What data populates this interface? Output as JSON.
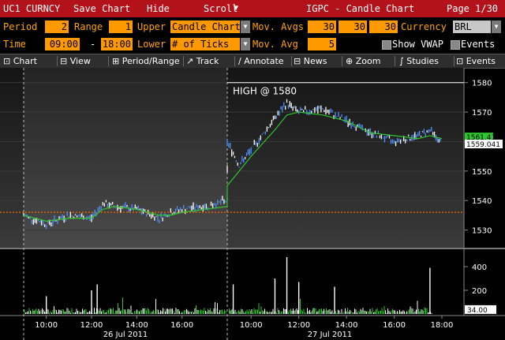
{
  "titlebar": {
    "ticker": "UC1 CURNCY",
    "save_chart": "Save Chart",
    "hide": "Hide",
    "scroll": "Scroll",
    "scroll_dropdown": "▼",
    "title": "IGPC - Candle Chart",
    "page": "Page 1/30"
  },
  "settings": {
    "period_label": "Period",
    "period_value": "2",
    "range_label": "Range",
    "range_value": "1",
    "upper_label": "Upper",
    "upper_value": "Candle Chart",
    "mov_avgs_label": "Mov. Avgs",
    "mov_avgs_values": [
      "30",
      "30",
      "30"
    ],
    "currency_label": "Currency",
    "currency_value": "BRL",
    "time_label": "Time",
    "time_start": "09:00",
    "time_sep": "-",
    "time_end": "18:00",
    "lower_label": "Lower",
    "lower_value": "# of Ticks",
    "mov_avg_label": "Mov. Avg",
    "mov_avg_value": "5",
    "show_vwap_label": "Show VWAP",
    "events_label": "Events"
  },
  "toolbar": {
    "items": [
      {
        "label": "Chart",
        "icon": "chart-icon"
      },
      {
        "label": "View",
        "icon": "view-icon"
      },
      {
        "label": "Period/Range",
        "icon": "period-icon"
      },
      {
        "label": "Track",
        "icon": "track-icon"
      },
      {
        "label": "Annotate",
        "icon": "annotate-icon"
      },
      {
        "label": "News",
        "icon": "news-icon"
      },
      {
        "label": "Zoom",
        "icon": "zoom-icon"
      },
      {
        "label": "Studies",
        "icon": "studies-icon"
      },
      {
        "label": "Events",
        "icon": "events-icon"
      }
    ]
  },
  "chart_data": {
    "type": "line",
    "annotation": "HIGH @ 1580",
    "price_axis": {
      "range": [
        1524,
        1585
      ],
      "ticks": [
        "1580",
        "1570",
        "1560",
        "1550",
        "1540",
        "1530"
      ]
    },
    "last_price_labels": [
      "1561.418",
      "1559.041"
    ],
    "volume_axis": {
      "range": [
        0,
        480
      ],
      "ticks": [
        "400",
        "200"
      ],
      "last_value": "34.00"
    },
    "x_ticks": [
      "10:00",
      "12:00",
      "14:00",
      "16:00",
      "10:00",
      "12:00",
      "14:00",
      "16:00",
      "18:00"
    ],
    "dates": [
      "26 Jul 2011",
      "27 Jul 2011"
    ],
    "series": [
      {
        "x": [
          "09:00",
          "10:00",
          "11:00",
          "12:00",
          "12:30",
          "13:00",
          "14:00",
          "15:00",
          "15:30",
          "16:00",
          "17:00",
          "18:00",
          "09:00",
          "09:30",
          "10:00",
          "11:00",
          "11:30",
          "12:00",
          "13:00",
          "14:00",
          "15:00",
          "16:00",
          "17:00",
          "17:30",
          "18:00"
        ],
        "values": [
          1535,
          1532,
          1535,
          1534,
          1539,
          1538,
          1537,
          1534,
          1536,
          1537,
          1538,
          1540,
          1560,
          1552,
          1557,
          1568,
          1573,
          1570,
          1571,
          1567,
          1563,
          1560,
          1562,
          1564,
          1559
        ]
      }
    ],
    "moving_average": [
      1535,
      1533,
      1534,
      1534,
      1537,
      1538,
      1537,
      1535,
      1535,
      1536,
      1537,
      1538,
      1545,
      1550,
      1555,
      1564,
      1569,
      1570,
      1569,
      1567,
      1563,
      1562,
      1561,
      1562,
      1561
    ],
    "volume": {
      "spikes": [
        {
          "x": "10:00",
          "value": 150
        },
        {
          "x": "12:00",
          "value": 200
        },
        {
          "x": "12:15",
          "value": 250
        },
        {
          "x": "09:15",
          "value": 250
        },
        {
          "x": "11:00",
          "value": 300
        },
        {
          "x": "11:30",
          "value": 480
        },
        {
          "x": "12:00",
          "value": 270
        },
        {
          "x": "13:30",
          "value": 230
        },
        {
          "x": "17:30",
          "value": 390
        }
      ],
      "baseline": 40
    },
    "colors": {
      "price": "#4a90ff",
      "moving_average": "#2ec52e",
      "volume": "#ffffff",
      "dotted_level": "#e06000",
      "annotation": "#ffffff"
    }
  }
}
